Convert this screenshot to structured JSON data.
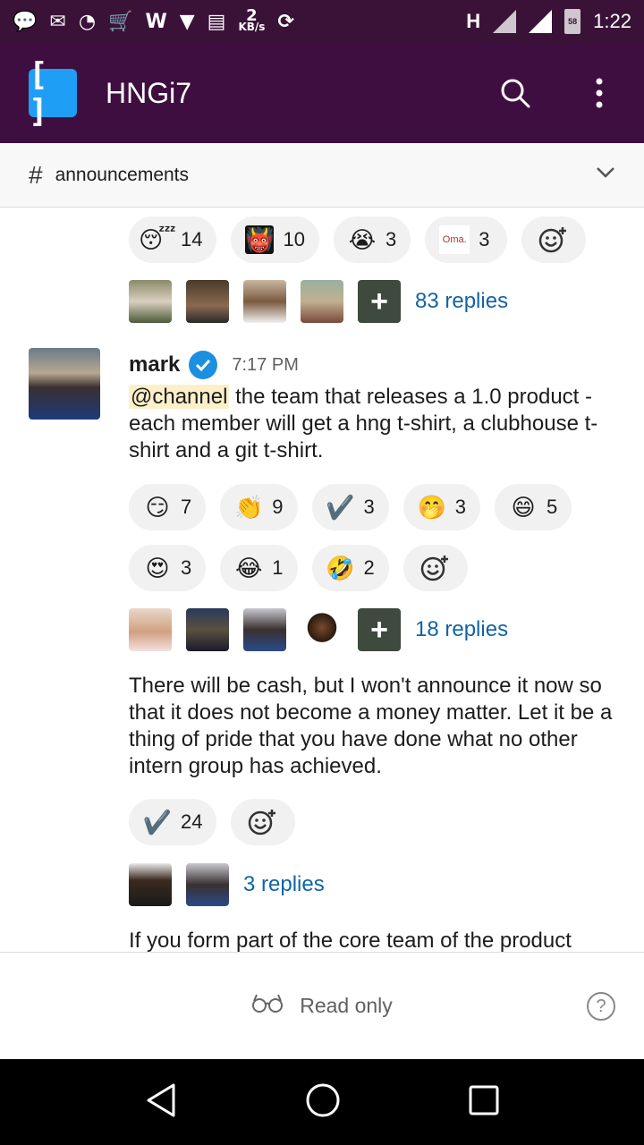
{
  "status_bar": {
    "speed_value": "2",
    "speed_unit": "KB/s",
    "network": "H",
    "battery": "58",
    "time": "1:22"
  },
  "app_bar": {
    "logo_text": "[ ]",
    "title": "HNGi7"
  },
  "channel": {
    "hash": "#",
    "name": "announcements"
  },
  "top_reactions": [
    {
      "emoji": "😴",
      "count": "14"
    },
    {
      "emoji": "👹",
      "count": "10"
    },
    {
      "emoji": "😭",
      "count": "3"
    },
    {
      "emoji": "Oma.",
      "count": "3"
    }
  ],
  "top_thread": {
    "replies": "83 replies"
  },
  "message": {
    "author": "mark",
    "time": "7:17 PM",
    "mention": "@channel",
    "text": " the team that releases a 1.0 product - each member will get a hng t-shirt, a clubhouse t-shirt and a git t-shirt.",
    "reactions_row1": [
      {
        "emoji": "😏",
        "count": "7"
      },
      {
        "emoji": "👏",
        "count": "9"
      },
      {
        "emoji": "✔️",
        "count": "3"
      },
      {
        "emoji": "🤭",
        "count": "3"
      },
      {
        "emoji": "😄",
        "count": "5"
      }
    ],
    "reactions_row2": [
      {
        "emoji": "😍",
        "count": "3"
      },
      {
        "emoji": "😂",
        "count": "1"
      },
      {
        "emoji": "🤣",
        "count": "2"
      }
    ],
    "replies": "18 replies"
  },
  "message2": {
    "text": "There will be cash, but I won't announce it now so that it does not become a money matter. Let it be a thing of pride that you have done what no other intern group has achieved.",
    "reaction": {
      "emoji": "✔️",
      "count": "24"
    },
    "replies": "3 replies"
  },
  "message3": {
    "text": "If you form part of the core team of the product"
  },
  "footer": {
    "readonly_label": "Read only",
    "help": "?"
  }
}
